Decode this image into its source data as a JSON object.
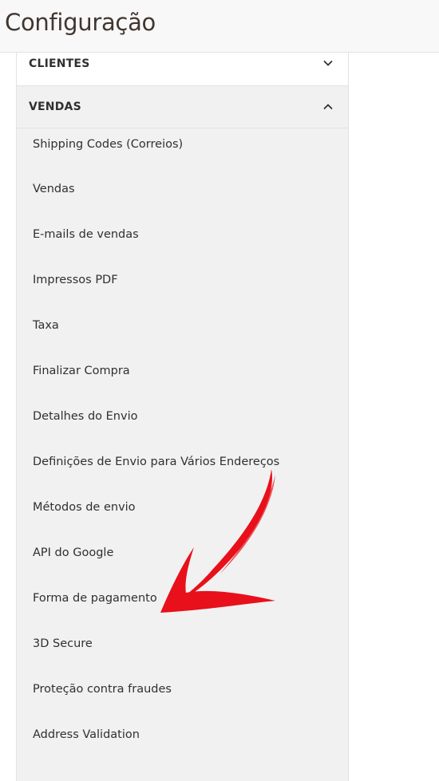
{
  "header": {
    "title": "Configuração"
  },
  "nav": {
    "sections": [
      {
        "label": "CLIENTES",
        "expanded": false,
        "icon": "chevron-down-icon"
      },
      {
        "label": "VENDAS",
        "expanded": true,
        "icon": "chevron-up-icon"
      }
    ],
    "vendas_items": [
      {
        "label": "Shipping Codes (Correios)"
      },
      {
        "label": "Vendas"
      },
      {
        "label": "E-mails de vendas"
      },
      {
        "label": "Impressos PDF"
      },
      {
        "label": "Taxa"
      },
      {
        "label": "Finalizar Compra"
      },
      {
        "label": "Detalhes do Envio"
      },
      {
        "label": "Definições de Envio para Vários Endereços"
      },
      {
        "label": "Métodos de envio"
      },
      {
        "label": "API do Google"
      },
      {
        "label": "Forma de pagamento"
      },
      {
        "label": "3D Secure"
      },
      {
        "label": "Proteção contra fraudes"
      },
      {
        "label": "Address Validation"
      }
    ]
  },
  "annotation": {
    "icon": "red-arrow-icon",
    "color": "#e8101a",
    "points_to": "Forma de pagamento"
  },
  "colors": {
    "header_bg": "#f8f8f8",
    "title_text": "#41362f",
    "nav_bg": "#f1f1f1",
    "border": "#e3e3e3",
    "item_text": "#303030"
  }
}
